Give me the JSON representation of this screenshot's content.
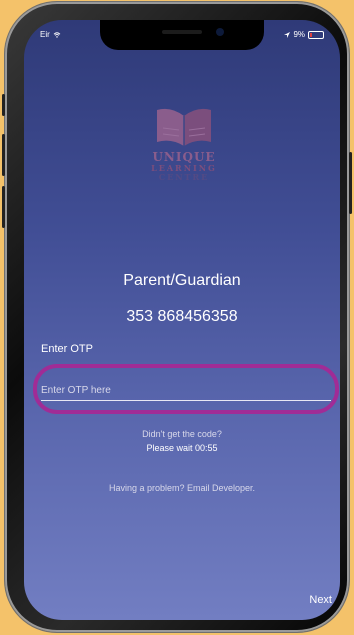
{
  "status_bar": {
    "carrier": "Eir",
    "battery": "9%"
  },
  "logo": {
    "line1": "UNIQUE",
    "line2": "LEARNING",
    "line3": "CENTRE"
  },
  "header": {
    "role": "Parent/Guardian",
    "phone_number": "353 868456358"
  },
  "otp": {
    "label": "Enter OTP",
    "placeholder": "Enter OTP here",
    "value": ""
  },
  "resend": {
    "prompt": "Didn't get the code?",
    "timer_text": "Please wait 00:55"
  },
  "help": {
    "text": "Having a problem? Email Developer."
  },
  "actions": {
    "next_label": "Next"
  },
  "colors": {
    "highlight_ring": "#a02c96",
    "background_top": "#2f3a78",
    "background_bottom": "#727ec2",
    "logo": "#8a5d8c"
  }
}
